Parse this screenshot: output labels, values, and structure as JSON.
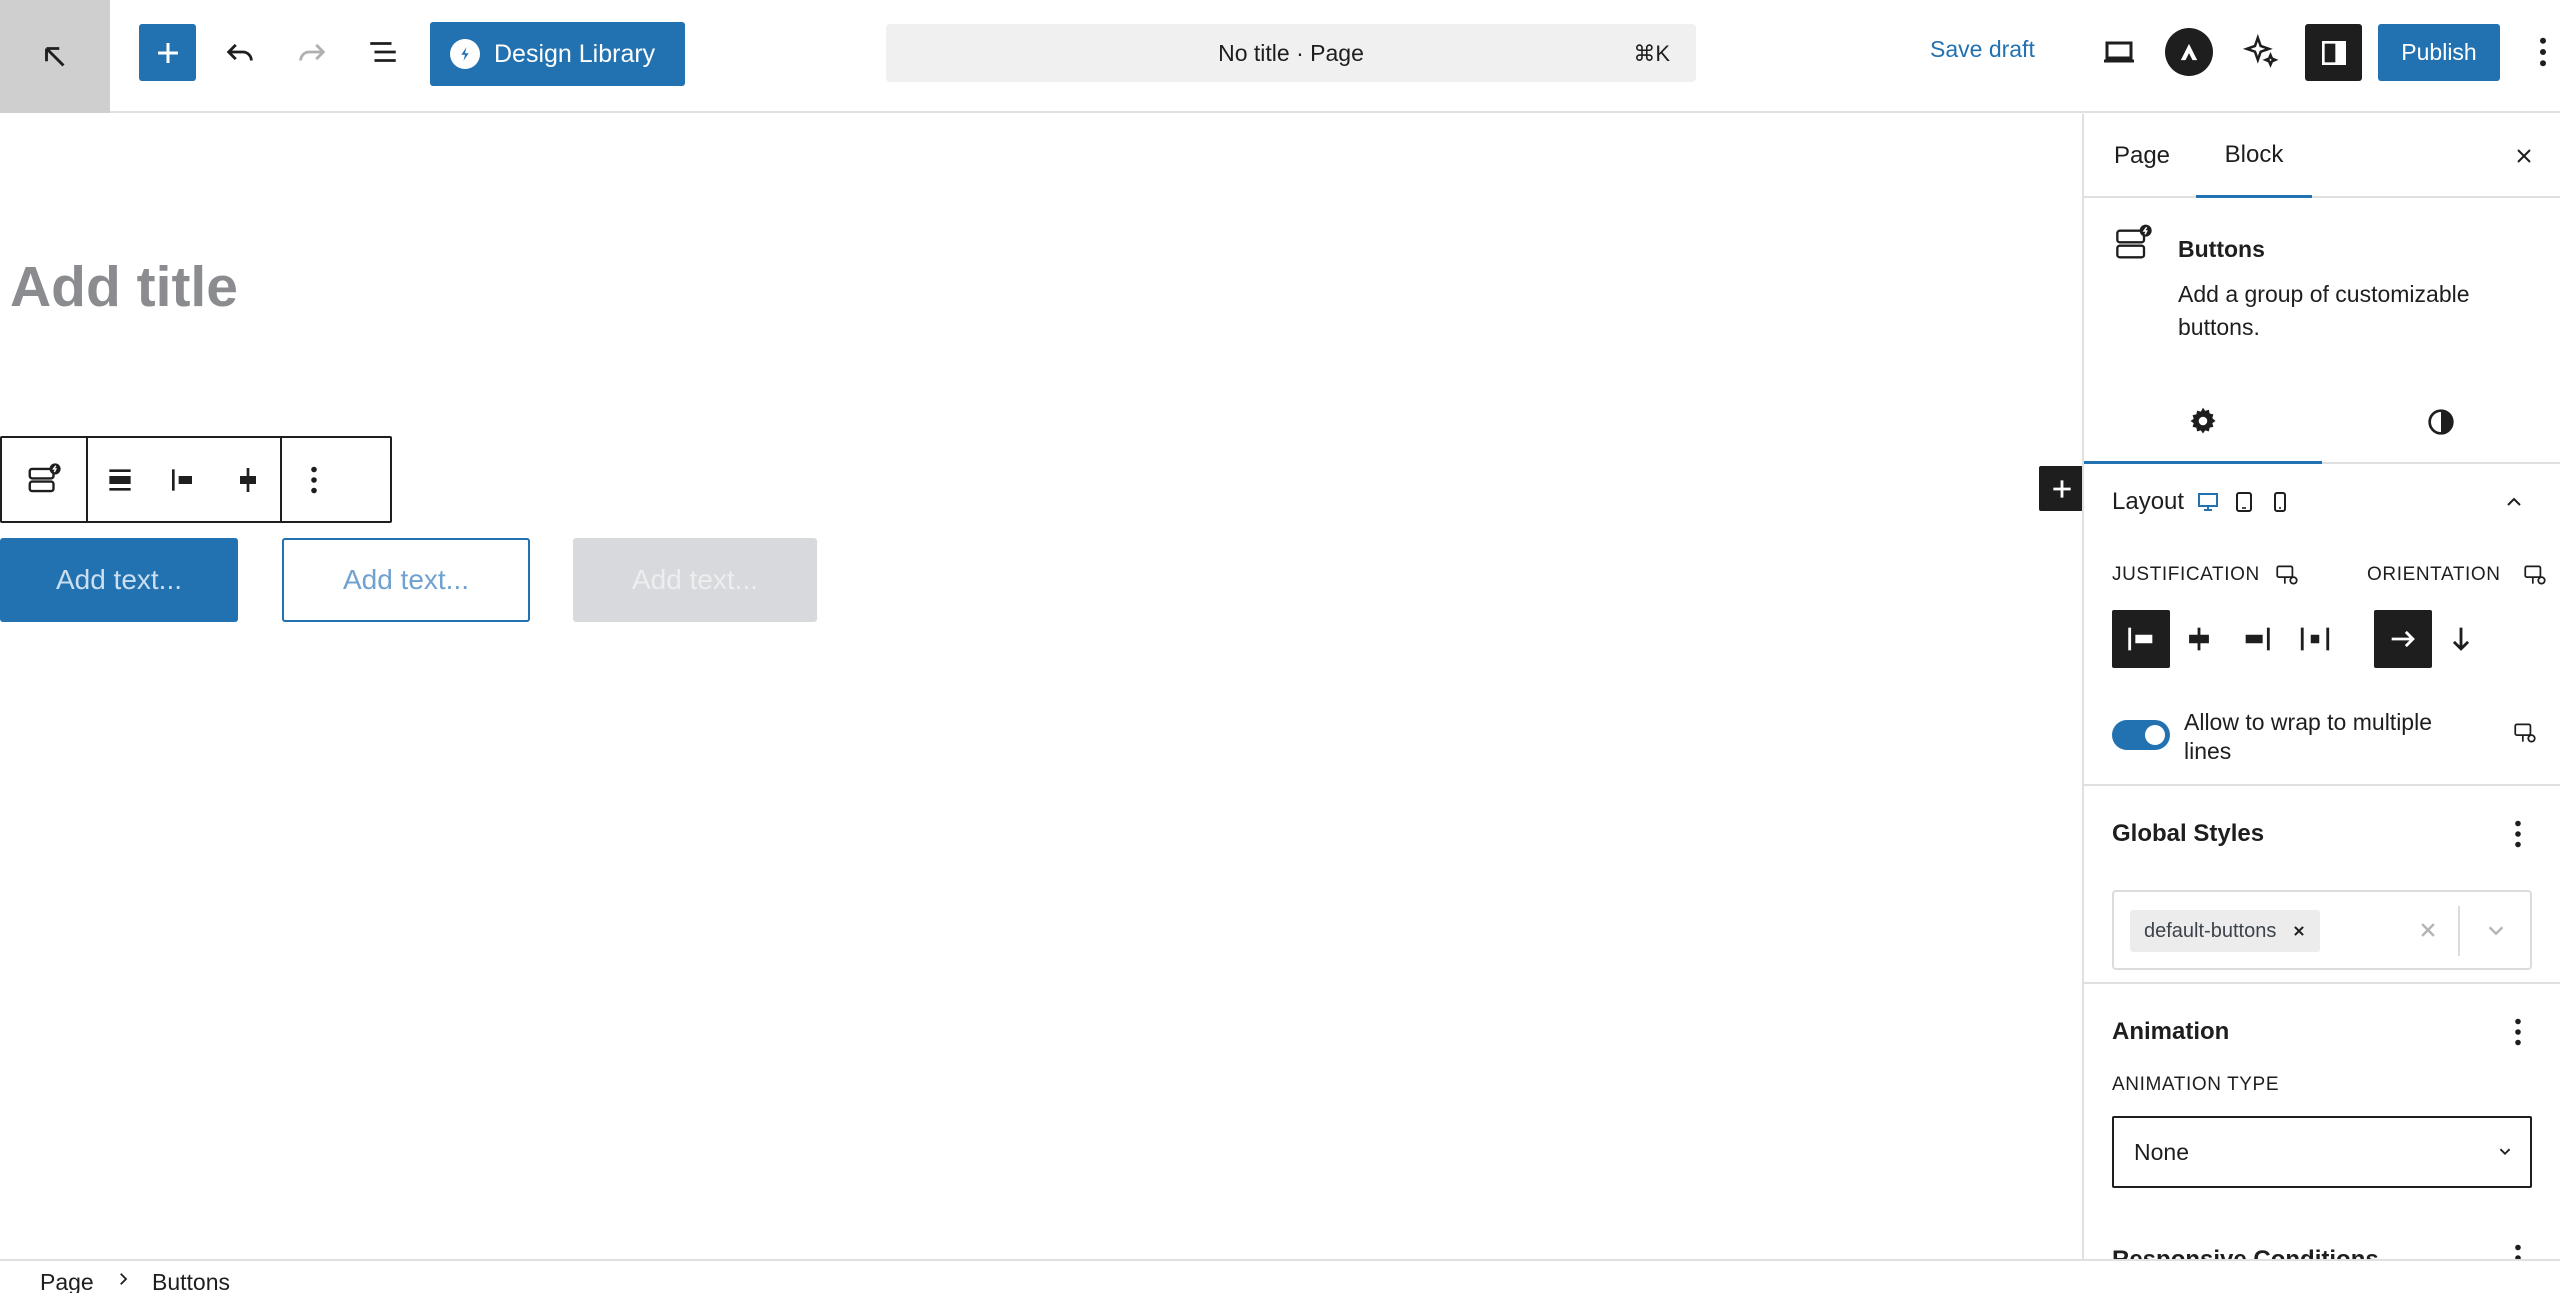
{
  "topbar": {
    "design_library": "Design Library",
    "document_title": "No title · Page",
    "shortcut": "⌘K",
    "save_draft": "Save draft",
    "publish": "Publish"
  },
  "canvas": {
    "title_placeholder": "Add title",
    "buttons": [
      "Add text...",
      "Add text...",
      "Add text..."
    ]
  },
  "sidebar": {
    "tabs": [
      "Page",
      "Block"
    ],
    "active_tab": "Block",
    "block_card": {
      "title": "Buttons",
      "description": "Add a group of customizable buttons."
    },
    "layout": {
      "title": "Layout",
      "justification_label": "JUSTIFICATION",
      "orientation_label": "ORIENTATION",
      "wrap_label": "Allow to wrap to multiple lines",
      "wrap_enabled": true
    },
    "global_styles": {
      "title": "Global Styles",
      "chip": "default-buttons"
    },
    "animation": {
      "title": "Animation",
      "type_label": "ANIMATION TYPE",
      "type_value": "None"
    },
    "responsive_title": "Responsive Conditions"
  },
  "breadcrumb": [
    "Page",
    "Buttons"
  ],
  "colors": {
    "accent": "#2271b1",
    "dark": "#1e1e1e"
  }
}
